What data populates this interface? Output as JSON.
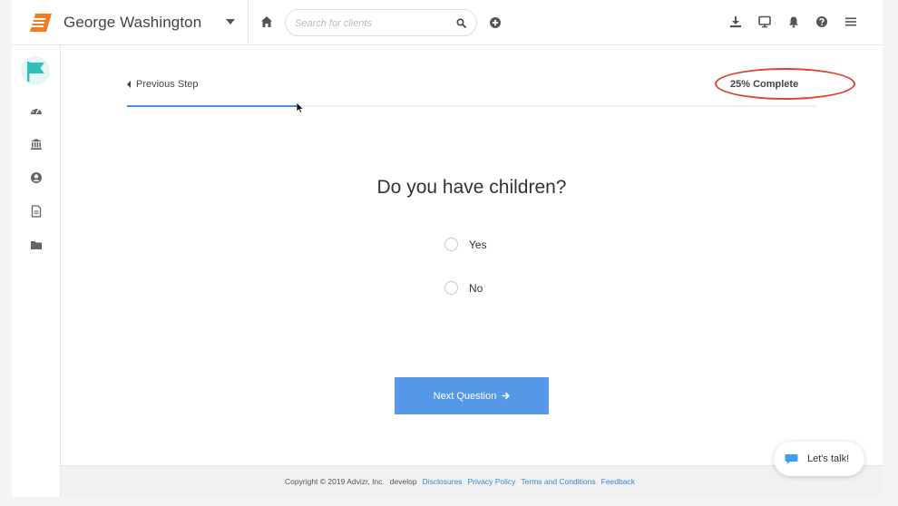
{
  "header": {
    "client_name": "George Washington",
    "search_placeholder": "Search for clients"
  },
  "wizard": {
    "previous_step_label": "Previous Step",
    "progress_label": "25% Complete",
    "progress_fraction": 0.25,
    "question": "Do you have children?",
    "options": [
      {
        "label": "Yes",
        "selected": false
      },
      {
        "label": "No",
        "selected": false
      }
    ],
    "next_button_label": "Next Question"
  },
  "footer": {
    "copyright": "Copyright © 2019 Advizr, Inc.",
    "env": "develop",
    "links": [
      "Disclosures",
      "Privacy Policy",
      "Terms and Conditions",
      "Feedback"
    ]
  },
  "chat": {
    "label": "Let's talk!"
  },
  "icons": {
    "logo": "advizr-logo-icon",
    "home": "home-icon",
    "search": "search-icon",
    "add": "add-circle-icon",
    "download": "download-icon",
    "monitor": "monitor-icon",
    "bell": "bell-icon",
    "help": "help-circle-icon",
    "menu": "menu-icon",
    "sidebar": [
      "flag-icon",
      "dashboard-icon",
      "bank-icon",
      "user-circle-icon",
      "document-icon",
      "folder-icon"
    ]
  },
  "colors": {
    "accent_blue": "#5598e8",
    "progress_blue": "#4a90e2",
    "logo_orange": "#f47b20",
    "flag_teal": "#2fc1b9",
    "highlight_red": "#e0402e",
    "link_blue": "#3a86d6"
  }
}
